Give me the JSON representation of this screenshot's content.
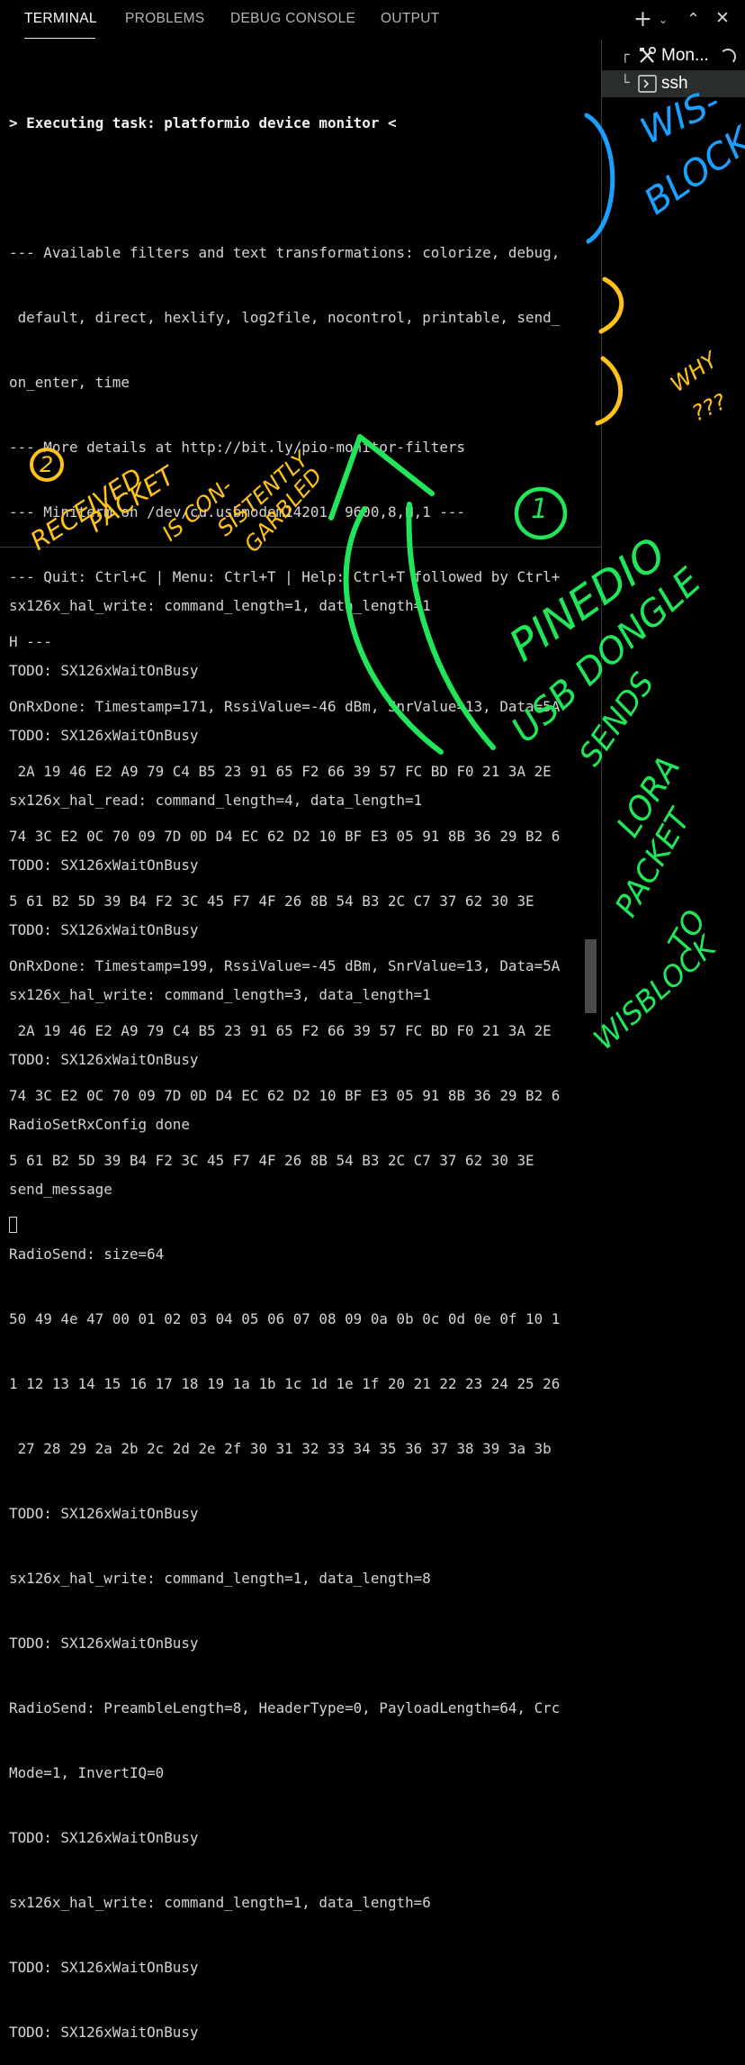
{
  "tabs": [
    "TERMINAL",
    "PROBLEMS",
    "DEBUG CONSOLE",
    "OUTPUT"
  ],
  "active_tab": "TERMINAL",
  "toolbar_icons": [
    "plus-icon",
    "chevron-down-icon",
    "chevron-up-icon",
    "close-icon"
  ],
  "terminal_top": {
    "lines": [
      "> Executing task: platformio device monitor <",
      "",
      "--- Available filters and text transformations: colorize, debug,",
      " default, direct, hexlify, log2file, nocontrol, printable, send_",
      "on_enter, time",
      "--- More details at http://bit.ly/pio-monitor-filters",
      "--- Miniterm on /dev/cu.usbmodem14201  9600,8,N,1 ---",
      "--- Quit: Ctrl+C | Menu: Ctrl+T | Help: Ctrl+T followed by Ctrl+",
      "H ---",
      "OnRxDone: Timestamp=171, RssiValue=-46 dBm, SnrValue=13, Data=5A",
      " 2A 19 46 E2 A9 79 C4 B5 23 91 65 F2 66 39 57 FC BD F0 21 3A 2E",
      "74 3C E2 0C 70 09 7D 0D D4 EC 62 D2 10 BF E3 05 91 8B 36 29 B2 6",
      "5 61 B2 5D 39 B4 F2 3C 45 F7 4F 26 8B 54 B3 2C C7 37 62 30 3E",
      "OnRxDone: Timestamp=199, RssiValue=-45 dBm, SnrValue=13, Data=5A",
      " 2A 19 46 E2 A9 79 C4 B5 23 91 65 F2 66 39 57 FC BD F0 21 3A 2E",
      "74 3C E2 0C 70 09 7D 0D D4 EC 62 D2 10 BF E3 05 91 8B 36 29 B2 6",
      "5 61 B2 5D 39 B4 F2 3C 45 F7 4F 26 8B 54 B3 2C C7 37 62 30 3E"
    ]
  },
  "terminal_bottom": {
    "lines": [
      "sx126x_hal_write: command_length=1, data_length=1",
      "TODO: SX126xWaitOnBusy",
      "TODO: SX126xWaitOnBusy",
      "sx126x_hal_read: command_length=4, data_length=1",
      "TODO: SX126xWaitOnBusy",
      "TODO: SX126xWaitOnBusy",
      "sx126x_hal_write: command_length=3, data_length=1",
      "TODO: SX126xWaitOnBusy",
      "RadioSetRxConfig done",
      "send_message",
      "RadioSend: size=64",
      "50 49 4e 47 00 01 02 03 04 05 06 07 08 09 0a 0b 0c 0d 0e 0f 10 1",
      "1 12 13 14 15 16 17 18 19 1a 1b 1c 1d 1e 1f 20 21 22 23 24 25 26",
      " 27 28 29 2a 2b 2c 2d 2e 2f 30 31 32 33 34 35 36 37 38 39 3a 3b",
      "TODO: SX126xWaitOnBusy",
      "sx126x_hal_write: command_length=1, data_length=8",
      "TODO: SX126xWaitOnBusy",
      "RadioSend: PreambleLength=8, HeaderType=0, PayloadLength=64, Crc",
      "Mode=1, InvertIQ=0",
      "TODO: SX126xWaitOnBusy",
      "sx126x_hal_write: command_length=1, data_length=6",
      "TODO: SX126xWaitOnBusy",
      "TODO: SX126xWaitOnBusy"
    ]
  },
  "terminal_list": [
    {
      "label": "Mon...",
      "icon": "tools-icon",
      "busy": true
    },
    {
      "label": "ssh",
      "icon": "terminal-prompt-icon",
      "busy": false
    }
  ],
  "annotations": {
    "wisblock": [
      "WIS-",
      "BLOCK"
    ],
    "why": [
      "WHY",
      "???"
    ],
    "received_number": "2",
    "received": [
      "RECEIVED",
      "PACKET",
      "IS CON-",
      "SISTENTLY",
      "GARBLED"
    ],
    "pinedio_number": "1",
    "pinedio": [
      "PINEDIO",
      "USB DONGLE",
      "SENDS",
      "LORA",
      "PACKET",
      "TO",
      "WISBLOCK"
    ]
  },
  "colors": {
    "blue_ink": "#1aa1ff",
    "yellow_ink": "#ffc21a",
    "green_ink": "#22e65a"
  }
}
